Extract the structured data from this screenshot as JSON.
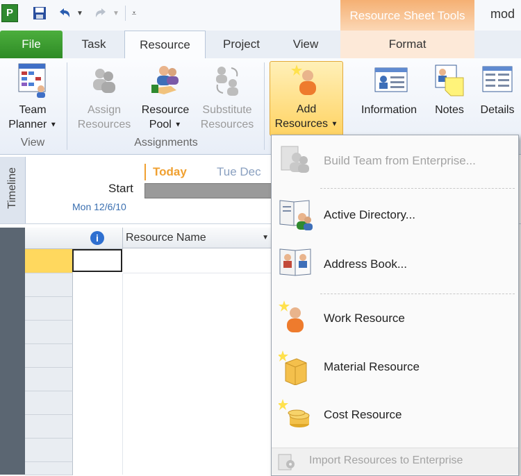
{
  "qat": {
    "app_letter": "P"
  },
  "window": {
    "title": "mod",
    "context_tab_group": "Resource Sheet Tools"
  },
  "tabs": [
    {
      "label": "File"
    },
    {
      "label": "Task"
    },
    {
      "label": "Resource"
    },
    {
      "label": "Project"
    },
    {
      "label": "View"
    },
    {
      "label": "Format"
    }
  ],
  "ribbon": {
    "view_group": {
      "label": "View",
      "team_planner": {
        "line1": "Team",
        "line2": "Planner"
      }
    },
    "assignments_group": {
      "label": "Assignments",
      "assign": {
        "line1": "Assign",
        "line2": "Resources"
      },
      "pool": {
        "line1": "Resource",
        "line2": "Pool"
      },
      "substitute": {
        "line1": "Substitute",
        "line2": "Resources"
      }
    },
    "add": {
      "line1": "Add",
      "line2": "Resources"
    },
    "information": "Information",
    "notes": "Notes",
    "details": "Details"
  },
  "timeline": {
    "tab_label": "Timeline",
    "today": "Today",
    "next_date": "Tue Dec",
    "start_label": "Start",
    "start_date": "Mon 12/6/10"
  },
  "grid": {
    "info_icon": "i",
    "col_resource_name": "Resource Name"
  },
  "add_menu": {
    "build_team": "Build Team from Enterprise...",
    "active_directory": "Active Directory...",
    "address_book": "Address Book...",
    "work_resource": "Work Resource",
    "material_resource": "Material Resource",
    "cost_resource": "Cost Resource",
    "import": "Import Resources to Enterprise"
  },
  "colors": {
    "file_tab": "#3a9a2e",
    "context_orange": "#f5a55e",
    "highlight": "#ffd363"
  }
}
